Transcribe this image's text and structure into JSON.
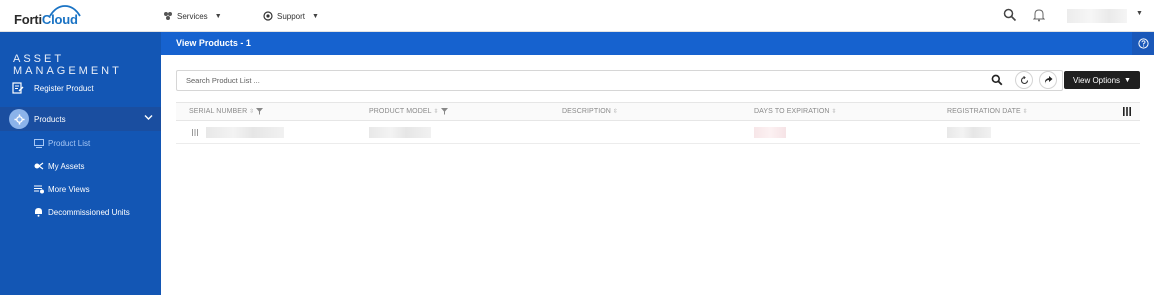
{
  "header": {
    "logo_part1": "Forti",
    "logo_part2": "Cloud",
    "nav": [
      {
        "label": "Services",
        "icon": "services-icon"
      },
      {
        "label": "Support",
        "icon": "support-icon"
      }
    ]
  },
  "sidebar": {
    "title": "ASSET MANAGEMENT",
    "items": [
      {
        "label": "Register Product",
        "icon": "register-icon"
      },
      {
        "label": "Products",
        "icon": "products-icon",
        "expanded": true
      }
    ],
    "sub_items": [
      {
        "label": "Product List",
        "icon": "list-icon",
        "active": true
      },
      {
        "label": "My Assets",
        "icon": "assets-icon"
      },
      {
        "label": "More Views",
        "icon": "views-icon"
      },
      {
        "label": "Decommissioned Units",
        "icon": "bell-icon"
      }
    ]
  },
  "main": {
    "title": "View Products - 1",
    "search_placeholder": "Search Product List ...",
    "view_options_label": "View Options",
    "columns": [
      {
        "label": "SERIAL NUMBER",
        "filterable": true
      },
      {
        "label": "PRODUCT MODEL",
        "filterable": true
      },
      {
        "label": "DESCRIPTION",
        "filterable": false
      },
      {
        "label": "DAYS TO EXPIRATION",
        "filterable": false
      },
      {
        "label": "REGISTRATION DATE",
        "filterable": false
      }
    ]
  },
  "colors": {
    "sidebar_bg": "#1356b4",
    "header_bar": "#1662cf",
    "active_sub": "#a8c8f5",
    "button_dark": "#1f1f1f"
  }
}
